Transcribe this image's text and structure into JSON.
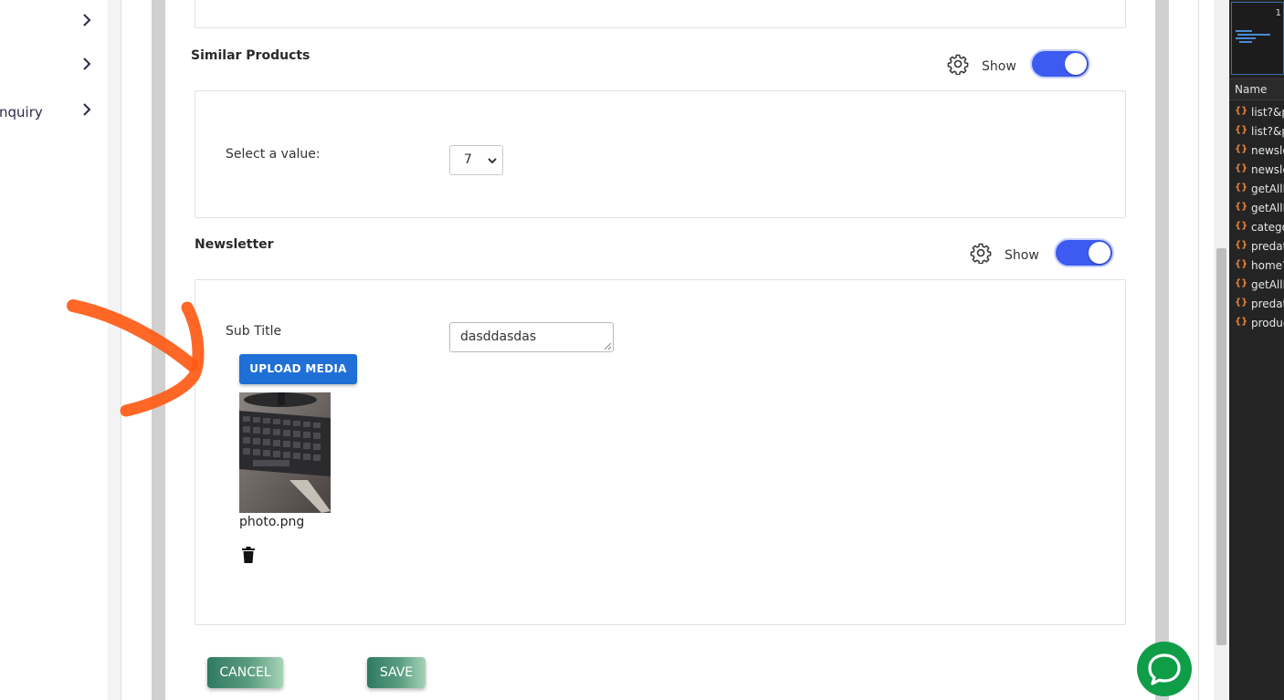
{
  "sidebar": {
    "items": [
      {
        "label": ""
      },
      {
        "label": ""
      },
      {
        "label": "nquiry"
      }
    ]
  },
  "similar_products": {
    "title": "Similar Products",
    "show_label": "Show",
    "select_label": "Select a value:",
    "select_value": "7"
  },
  "newsletter": {
    "title": "Newsletter",
    "show_label": "Show",
    "sub_title_label": "Sub Title",
    "sub_title_value": "dasddasdas",
    "upload_label": "UPLOAD MEDIA",
    "file_name": "photo.png"
  },
  "actions": {
    "cancel_label": "CANCEL",
    "save_label": "SAVE"
  },
  "devtools": {
    "top_value": "1",
    "column_header": "Name",
    "rows": [
      "list?&p",
      "list?&p",
      "newsle",
      "newsle",
      "getAllP",
      "getAllP",
      "catego",
      "predata",
      "home?",
      "getAllP",
      "predata",
      "produc"
    ]
  },
  "colors": {
    "toggle_on": "#3d5af1",
    "upload_button": "#1f6fd6",
    "chat_button": "#0f9d48",
    "annotation_arrow": "#ff5a14"
  }
}
